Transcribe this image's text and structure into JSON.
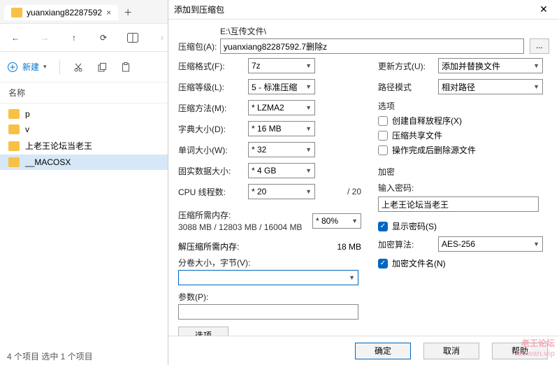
{
  "explorer": {
    "tab_title": "yuanxiang82287592",
    "new_btn": "新建",
    "header_name": "名称",
    "files": [
      "p",
      "v",
      "上老王论坛当老王",
      "__MACOSX"
    ],
    "status": "4 个项目    选中 1 个项目"
  },
  "dialog": {
    "title": "添加到压缩包",
    "path_label": "压缩包(A):",
    "path_hint": "E:\\互传文件\\",
    "path_value": "yuanxiang82287592.7删除z",
    "dots": "...",
    "left": {
      "format_l": "压缩格式(F):",
      "format_v": "7z",
      "level_l": "压缩等级(L):",
      "level_v": "5 - 标准压缩",
      "method_l": "压缩方法(M):",
      "method_v": "* LZMA2",
      "dict_l": "字典大小(D):",
      "dict_v": "* 16 MB",
      "word_l": "单词大小(W):",
      "word_v": "* 32",
      "solid_l": "固实数据大小:",
      "solid_v": "* 4 GB",
      "cpu_l": "CPU 线程数:",
      "cpu_v": "* 20",
      "cpu_total": "/ 20",
      "memc_l": "压缩所需内存:",
      "memc_v": "3088 MB / 12803 MB / 16004 MB",
      "memc_pct": "* 80%",
      "memd_l": "解压缩所需内存:",
      "memd_v": "18 MB",
      "split_l": "分卷大小，字节(V):",
      "params_l": "参数(P):",
      "options_btn": "选项"
    },
    "right": {
      "update_l": "更新方式(U):",
      "update_v": "添加并替换文件",
      "pathmode_l": "路径模式",
      "pathmode_v": "相对路径",
      "opts_h": "选项",
      "sfx": "创建自释放程序(X)",
      "shared": "压缩共享文件",
      "del": "操作完成后删除源文件",
      "enc_h": "加密",
      "pwd_l": "输入密码:",
      "pwd_v": "上老王论坛当老王",
      "show_pwd": "显示密码(S)",
      "algo_l": "加密算法:",
      "algo_v": "AES-256",
      "enc_names": "加密文件名(N)"
    },
    "footer": {
      "ok": "确定",
      "cancel": "取消",
      "help": "帮助"
    }
  },
  "watermark": {
    "line1": "老王论坛",
    "line2": "laowan.vip"
  }
}
